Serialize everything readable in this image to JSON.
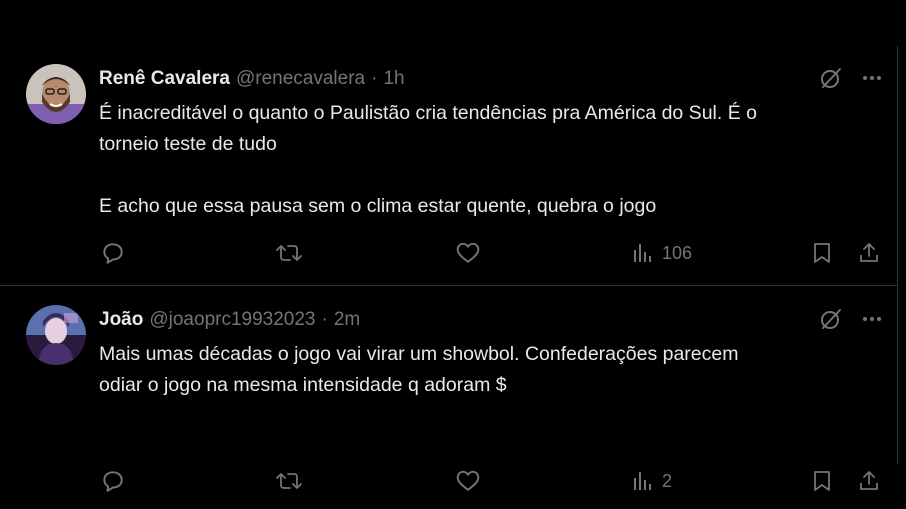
{
  "tweets": [
    {
      "display_name": "Renê Cavalera",
      "handle": "@renecavalera",
      "separator": "·",
      "time": "1h",
      "avatar_icon": "person-avatar-icon",
      "text_lines": [
        "É inacreditável o quanto o Paulistão cria tendências pra América do Sul. É o",
        "torneio teste de tudo",
        "E acho que essa pausa sem o clima estar quente, quebra o jogo"
      ],
      "views": "106"
    },
    {
      "display_name": "João",
      "handle": "@joaoprc19932023",
      "separator": "·",
      "time": "2m",
      "avatar_icon": "person-avatar-icon",
      "text_lines": [
        "Mais umas décadas o jogo vai virar um  showbol. Confederações parecem",
        "odiar o jogo na mesma intensidade q  adoram $"
      ],
      "views": "2"
    }
  ],
  "icons": {
    "grok": "grok-icon",
    "more": "more-icon",
    "reply": "reply-icon",
    "retweet": "retweet-icon",
    "like": "heart-icon",
    "views": "views-icon",
    "bookmark": "bookmark-icon",
    "share": "share-icon"
  },
  "colors": {
    "background": "#000000",
    "text_primary": "#e7e9ea",
    "text_secondary": "#71767b",
    "divider": "#2f3336"
  }
}
